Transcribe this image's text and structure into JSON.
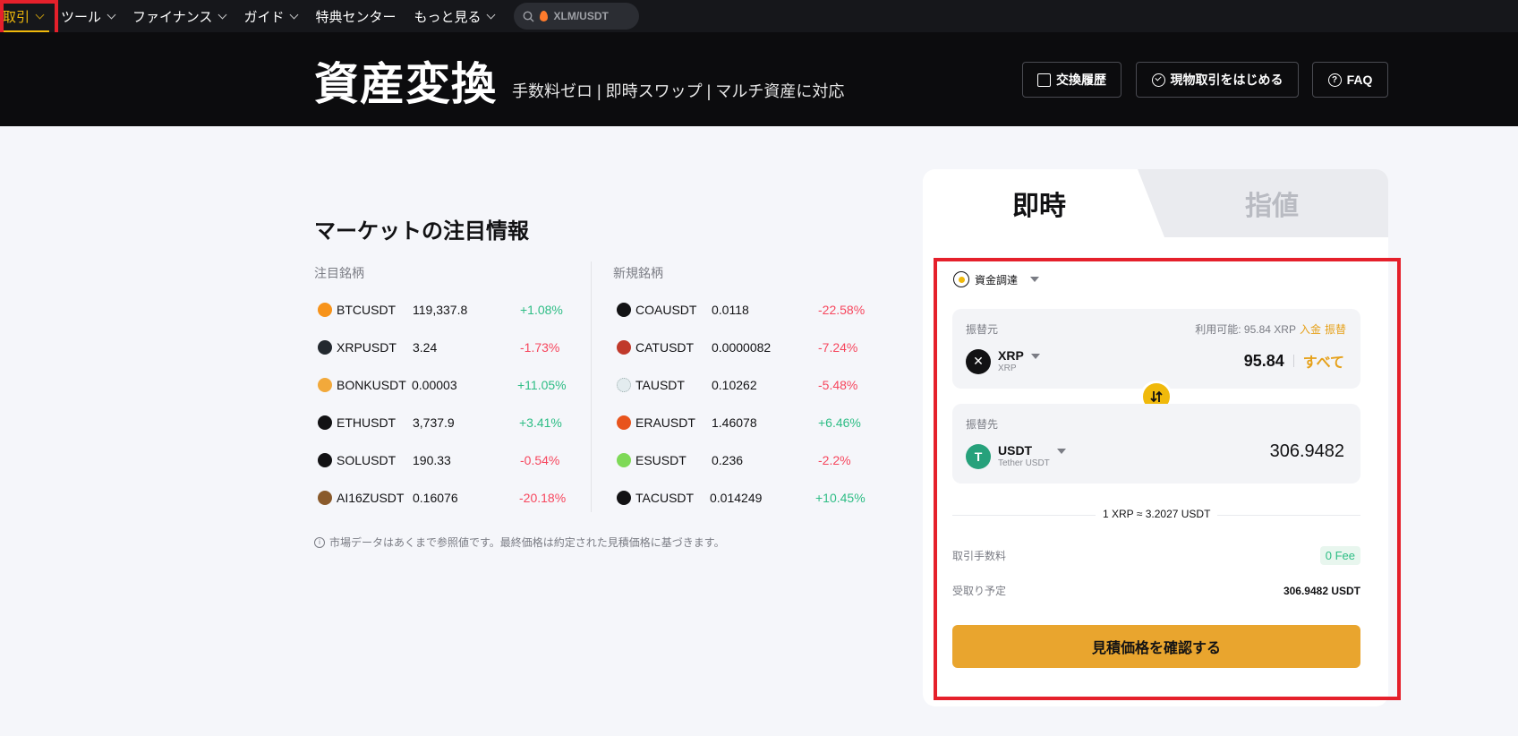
{
  "nav": {
    "items": [
      {
        "label": "取引"
      },
      {
        "label": "ツール"
      },
      {
        "label": "ファイナンス"
      },
      {
        "label": "ガイド"
      },
      {
        "label": "特典センター"
      },
      {
        "label": "もっと見る"
      }
    ],
    "search_text": "XLM/USDT"
  },
  "hero": {
    "title": "資産変換",
    "subtitle": "手数料ゼロ | 即時スワップ | マルチ資産に対応",
    "buttons": {
      "history": "交換履歴",
      "spot": "現物取引をはじめる",
      "faq": "FAQ"
    }
  },
  "market": {
    "title": "マーケットの注目情報",
    "featured_heading": "注目銘柄",
    "new_heading": "新規銘柄",
    "featured": [
      {
        "symbol": "BTCUSDT",
        "price": "119,337.8",
        "change": "+1.08%",
        "dir": "up",
        "color": "#f7931a"
      },
      {
        "symbol": "XRPUSDT",
        "price": "3.24",
        "change": "-1.73%",
        "dir": "down",
        "color": "#23292f"
      },
      {
        "symbol": "BONKUSDT",
        "price": "0.00003",
        "change": "+11.05%",
        "dir": "up",
        "color": "#f2a93b"
      },
      {
        "symbol": "ETHUSDT",
        "price": "3,737.9",
        "change": "+3.41%",
        "dir": "up",
        "color": "#121214"
      },
      {
        "symbol": "SOLUSDT",
        "price": "190.33",
        "change": "-0.54%",
        "dir": "down",
        "color": "#121214"
      },
      {
        "symbol": "AI16ZUSDT",
        "price": "0.16076",
        "change": "-20.18%",
        "dir": "down",
        "color": "#8a5a2b"
      }
    ],
    "new": [
      {
        "symbol": "COAUSDT",
        "price": "0.0118",
        "change": "-22.58%",
        "dir": "down",
        "color": "#121214"
      },
      {
        "symbol": "CATUSDT",
        "price": "0.0000082",
        "change": "-7.24%",
        "dir": "down",
        "color": "#c0392b"
      },
      {
        "symbol": "TAUSDT",
        "price": "0.10262",
        "change": "-5.48%",
        "dir": "down",
        "color": "#cfd8dc"
      },
      {
        "symbol": "ERAUSDT",
        "price": "1.46078",
        "change": "+6.46%",
        "dir": "up",
        "color": "#e8541d"
      },
      {
        "symbol": "ESUSDT",
        "price": "0.236",
        "change": "-2.2%",
        "dir": "down",
        "color": "#7ed957"
      },
      {
        "symbol": "TACUSDT",
        "price": "0.014249",
        "change": "+10.45%",
        "dir": "up",
        "color": "#121214"
      }
    ],
    "disclaimer": "市場データはあくまで参照値です。最終価格は約定された見積価格に基づきます。"
  },
  "convert": {
    "tab_instant": "即時",
    "tab_limit": "指値",
    "account": "資金調達",
    "from": {
      "label": "振替元",
      "available": "利用可能: 95.84 XRP",
      "deposit": "入金",
      "transfer": "振替",
      "symbol": "XRP",
      "name": "XRP",
      "amount": "95.84",
      "max": "すべて"
    },
    "to": {
      "label": "振替先",
      "symbol": "USDT",
      "name": "Tether USDT",
      "amount": "306.9482"
    },
    "rate": "1 XRP ≈ 3.2027 USDT",
    "fee_label": "取引手数料",
    "fee_value": "0 Fee",
    "receive_label": "受取り予定",
    "receive_value": "306.9482 USDT",
    "confirm": "見積価格を確認する"
  },
  "colors": {
    "accent": "#f0b90b",
    "up": "#2ebd85",
    "down": "#f6465d",
    "highlight_box": "#e5202b"
  }
}
